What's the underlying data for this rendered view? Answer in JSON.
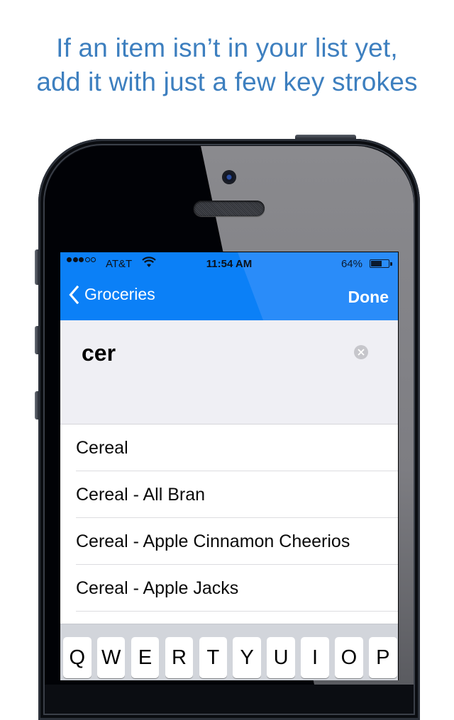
{
  "headline": {
    "line1": "If an item isn’t in your list yet,",
    "line2": "add it with just a few key strokes"
  },
  "colors": {
    "headline": "#3d7fbf",
    "nav_bar": "#0b80f7",
    "entry_background": "#efeff4",
    "keyboard_background": "#d2d5db"
  },
  "status_bar": {
    "signal_bars_filled": 3,
    "signal_bars_total": 5,
    "carrier": "AT&T",
    "wifi_icon": "wifi-icon",
    "time": "11:54 AM",
    "battery_percent_label": "64%",
    "battery_level": 0.64
  },
  "nav": {
    "back_label": "Groceries",
    "back_icon": "chevron-left-icon",
    "done_label": "Done"
  },
  "entry": {
    "value": "cer",
    "clear_icon": "clear-circle-icon"
  },
  "suggestions": [
    {
      "label": "Cereal"
    },
    {
      "label": "Cereal - All Bran"
    },
    {
      "label": "Cereal - Apple Cinnamon Cheerios"
    },
    {
      "label": "Cereal - Apple Jacks"
    }
  ],
  "keyboard": {
    "row1": [
      "Q",
      "W",
      "E",
      "R",
      "T",
      "Y",
      "U",
      "I",
      "O",
      "P"
    ]
  }
}
